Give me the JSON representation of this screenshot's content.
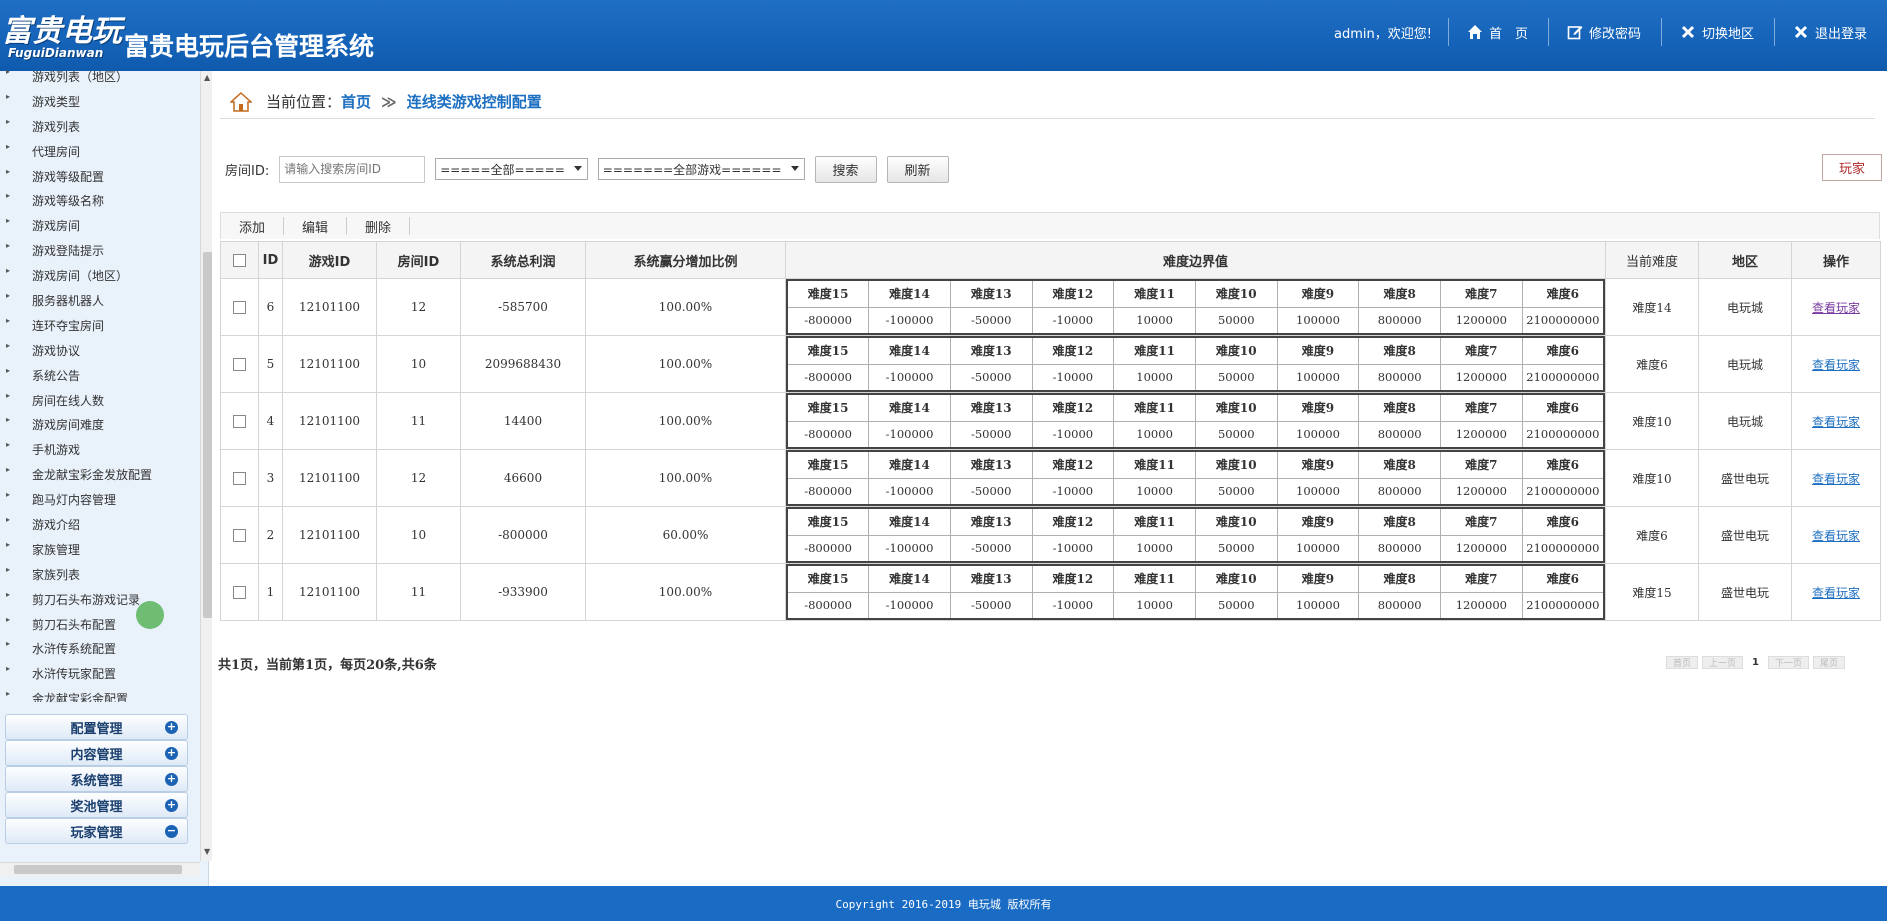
{
  "header": {
    "logo_line1": "富贵电玩",
    "logo_line2": "FuguiDianwan",
    "title": "富贵电玩后台管理系统",
    "welcome": "admin，欢迎您!",
    "nav": [
      {
        "label": "首　页",
        "icon": "home-icon"
      },
      {
        "label": "修改密码",
        "icon": "edit-icon"
      },
      {
        "label": "切换地区",
        "icon": "close-icon"
      },
      {
        "label": "退出登录",
        "icon": "close-icon"
      }
    ]
  },
  "sidebar": {
    "items": [
      "游戏列表（地区）",
      "游戏类型",
      "游戏列表",
      "代理房间",
      "游戏等级配置",
      "游戏等级名称",
      "游戏房间",
      "游戏登陆提示",
      "游戏房间（地区）",
      "服务器机器人",
      "连环夺宝房间",
      "游戏协议",
      "系统公告",
      "房间在线人数",
      "游戏房间难度",
      "手机游戏",
      "金龙献宝彩金发放配置",
      "跑马灯内容管理",
      "游戏介绍",
      "家族管理",
      "家族列表",
      "剪刀石头布游戏记录",
      "剪刀石头布配置",
      "水浒传系统配置",
      "水浒传玩家配置",
      "金龙献宝彩金配置"
    ],
    "groups": [
      {
        "label": "配置管理",
        "state": "+"
      },
      {
        "label": "内容管理",
        "state": "+"
      },
      {
        "label": "系统管理",
        "state": "+"
      },
      {
        "label": "奖池管理",
        "state": "+"
      },
      {
        "label": "玩家管理",
        "state": "−"
      }
    ]
  },
  "breadcrumb": {
    "label": "当前位置：",
    "home": "首页",
    "sep": "≫",
    "current": "连线类游戏控制配置"
  },
  "toolbar": {
    "room_label": "房间ID:",
    "room_placeholder": "请输入搜索房间ID",
    "select_area": "=====全部=====",
    "select_game": "=======全部游戏======",
    "search": "搜索",
    "refresh": "刷新",
    "player": "玩家"
  },
  "actions": [
    "添加",
    "编辑",
    "删除"
  ],
  "table": {
    "headers": [
      "ID",
      "游戏ID",
      "房间ID",
      "系统总利润",
      "系统赢分增加比例",
      "难度边界值",
      "当前难度",
      "地区",
      "操作"
    ],
    "levels": [
      "难度15",
      "难度14",
      "难度13",
      "难度12",
      "难度11",
      "难度10",
      "难度9",
      "难度8",
      "难度7",
      "难度6"
    ],
    "boundaries": [
      "-800000",
      "-100000",
      "-50000",
      "-10000",
      "10000",
      "50000",
      "100000",
      "800000",
      "1200000",
      "2100000000"
    ],
    "view_label": "查看玩家",
    "rows": [
      {
        "id": "6",
        "game_id": "12101100",
        "room_id": "12",
        "profit": "-585700",
        "ratio": "100.00%",
        "current": "难度14",
        "area": "电玩城",
        "visited": true
      },
      {
        "id": "5",
        "game_id": "12101100",
        "room_id": "10",
        "profit": "2099688430",
        "ratio": "100.00%",
        "current": "难度6",
        "area": "电玩城",
        "visited": false
      },
      {
        "id": "4",
        "game_id": "12101100",
        "room_id": "11",
        "profit": "14400",
        "ratio": "100.00%",
        "current": "难度10",
        "area": "电玩城",
        "visited": false
      },
      {
        "id": "3",
        "game_id": "12101100",
        "room_id": "12",
        "profit": "46600",
        "ratio": "100.00%",
        "current": "难度10",
        "area": "盛世电玩",
        "visited": false
      },
      {
        "id": "2",
        "game_id": "12101100",
        "room_id": "10",
        "profit": "-800000",
        "ratio": "60.00%",
        "current": "难度6",
        "area": "盛世电玩",
        "visited": false
      },
      {
        "id": "1",
        "game_id": "12101100",
        "room_id": "11",
        "profit": "-933900",
        "ratio": "100.00%",
        "current": "难度15",
        "area": "盛世电玩",
        "visited": false
      }
    ]
  },
  "pagination": {
    "info": "共1页，当前第1页，每页20条,共6条",
    "first": "首页",
    "prev": "上一页",
    "current": "1",
    "next": "下一页",
    "last": "尾页"
  },
  "footer": {
    "copyright": "Copyright 2016-2019 电玩城 版权所有"
  }
}
